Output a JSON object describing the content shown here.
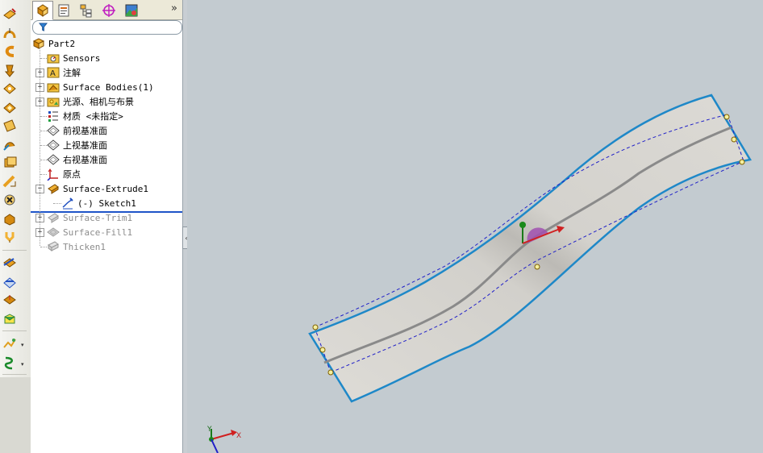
{
  "feature_tree": {
    "tabs": [
      {
        "name": "feature-manager",
        "icon": "feature-manager-icon"
      },
      {
        "name": "property-manager",
        "icon": "property-manager-icon"
      },
      {
        "name": "configuration-manager",
        "icon": "configuration-manager-icon"
      },
      {
        "name": "dimxpert-manager",
        "icon": "crosshair-icon"
      },
      {
        "name": "display-manager",
        "icon": "display-manager-icon"
      }
    ],
    "more_label": "»",
    "filter_placeholder": "",
    "part_name": "Part2",
    "items": [
      {
        "label": "Sensors",
        "icon": "sensors-folder-icon",
        "expandable": false,
        "dim": false
      },
      {
        "label": "注解",
        "icon": "annotations-icon",
        "expandable": true,
        "dim": false
      },
      {
        "label": "Surface Bodies(1)",
        "icon": "surface-bodies-folder-icon",
        "expandable": true,
        "dim": false
      },
      {
        "label": "光源、相机与布景",
        "icon": "lights-cameras-scene-icon",
        "expandable": true,
        "dim": false
      },
      {
        "label": "材质 <未指定>",
        "icon": "material-icon",
        "expandable": false,
        "dim": false
      },
      {
        "label": "前视基准面",
        "icon": "plane-icon",
        "expandable": false,
        "dim": false
      },
      {
        "label": "上视基准面",
        "icon": "plane-icon",
        "expandable": false,
        "dim": false
      },
      {
        "label": "右视基准面",
        "icon": "plane-icon",
        "expandable": false,
        "dim": false
      },
      {
        "label": "原点",
        "icon": "origin-icon",
        "expandable": false,
        "dim": false
      },
      {
        "label": "Surface-Extrude1",
        "icon": "surface-extrude-icon",
        "expandable": true,
        "expanded": true,
        "dim": false
      },
      {
        "label": "(-) Sketch1",
        "icon": "sketch-icon",
        "expandable": false,
        "dim": false,
        "child": true
      },
      {
        "label": "Surface-Trim1",
        "icon": "surface-trim-icon",
        "expandable": true,
        "dim": true
      },
      {
        "label": "Surface-Fill1",
        "icon": "surface-fill-icon",
        "expandable": true,
        "dim": true
      },
      {
        "label": "Thicken1",
        "icon": "thicken-icon",
        "expandable": false,
        "dim": true
      }
    ]
  },
  "toolbar": {
    "tools": [
      {
        "name": "extruded-surface",
        "icon": "extruded-surface-icon"
      },
      {
        "name": "revolved-surface",
        "icon": "revolved-surface-icon"
      },
      {
        "name": "swept-surface",
        "icon": "swept-surface-icon"
      },
      {
        "name": "lofted-surface",
        "icon": "lofted-surface-icon"
      },
      {
        "name": "boundary-surface",
        "icon": "boundary-surface-icon"
      },
      {
        "name": "filled-surface",
        "icon": "filled-surface-icon"
      },
      {
        "name": "planar-surface",
        "icon": "planar-surface-icon"
      },
      {
        "name": "offset-surface",
        "icon": "offset-surface-icon"
      },
      {
        "name": "radiate-surface",
        "icon": "radiate-surface-icon"
      },
      {
        "name": "knit-surface",
        "icon": "knit-surface-icon"
      },
      {
        "name": "delete-face",
        "icon": "delete-face-icon"
      },
      {
        "name": "untrim-surface",
        "icon": "untrim-surface-icon"
      },
      {
        "name": "trim-surface",
        "icon": "trim-surface-icon"
      },
      {
        "name": "extend-surface",
        "icon": "extend-surface-icon"
      },
      {
        "name": "replace-face",
        "icon": "replace-face-icon"
      },
      {
        "name": "thicken",
        "icon": "thicken-icon"
      },
      {
        "name": "fillet",
        "icon": "fillet-icon"
      },
      {
        "name": "mid-surface",
        "icon": "mid-surface-icon"
      },
      {
        "name": "ruled-surface",
        "icon": "ruled-surface-icon"
      }
    ]
  },
  "viewport": {
    "colors": {
      "background": "#c3cbd0",
      "surface_fill": "#d8d6d1",
      "surface_edge": "#1e88c8",
      "sketch_dash": "#2020c8",
      "sketch_curve": "#8a8a8a"
    },
    "triad": {
      "x_label": "X",
      "y_label": "Y"
    }
  }
}
